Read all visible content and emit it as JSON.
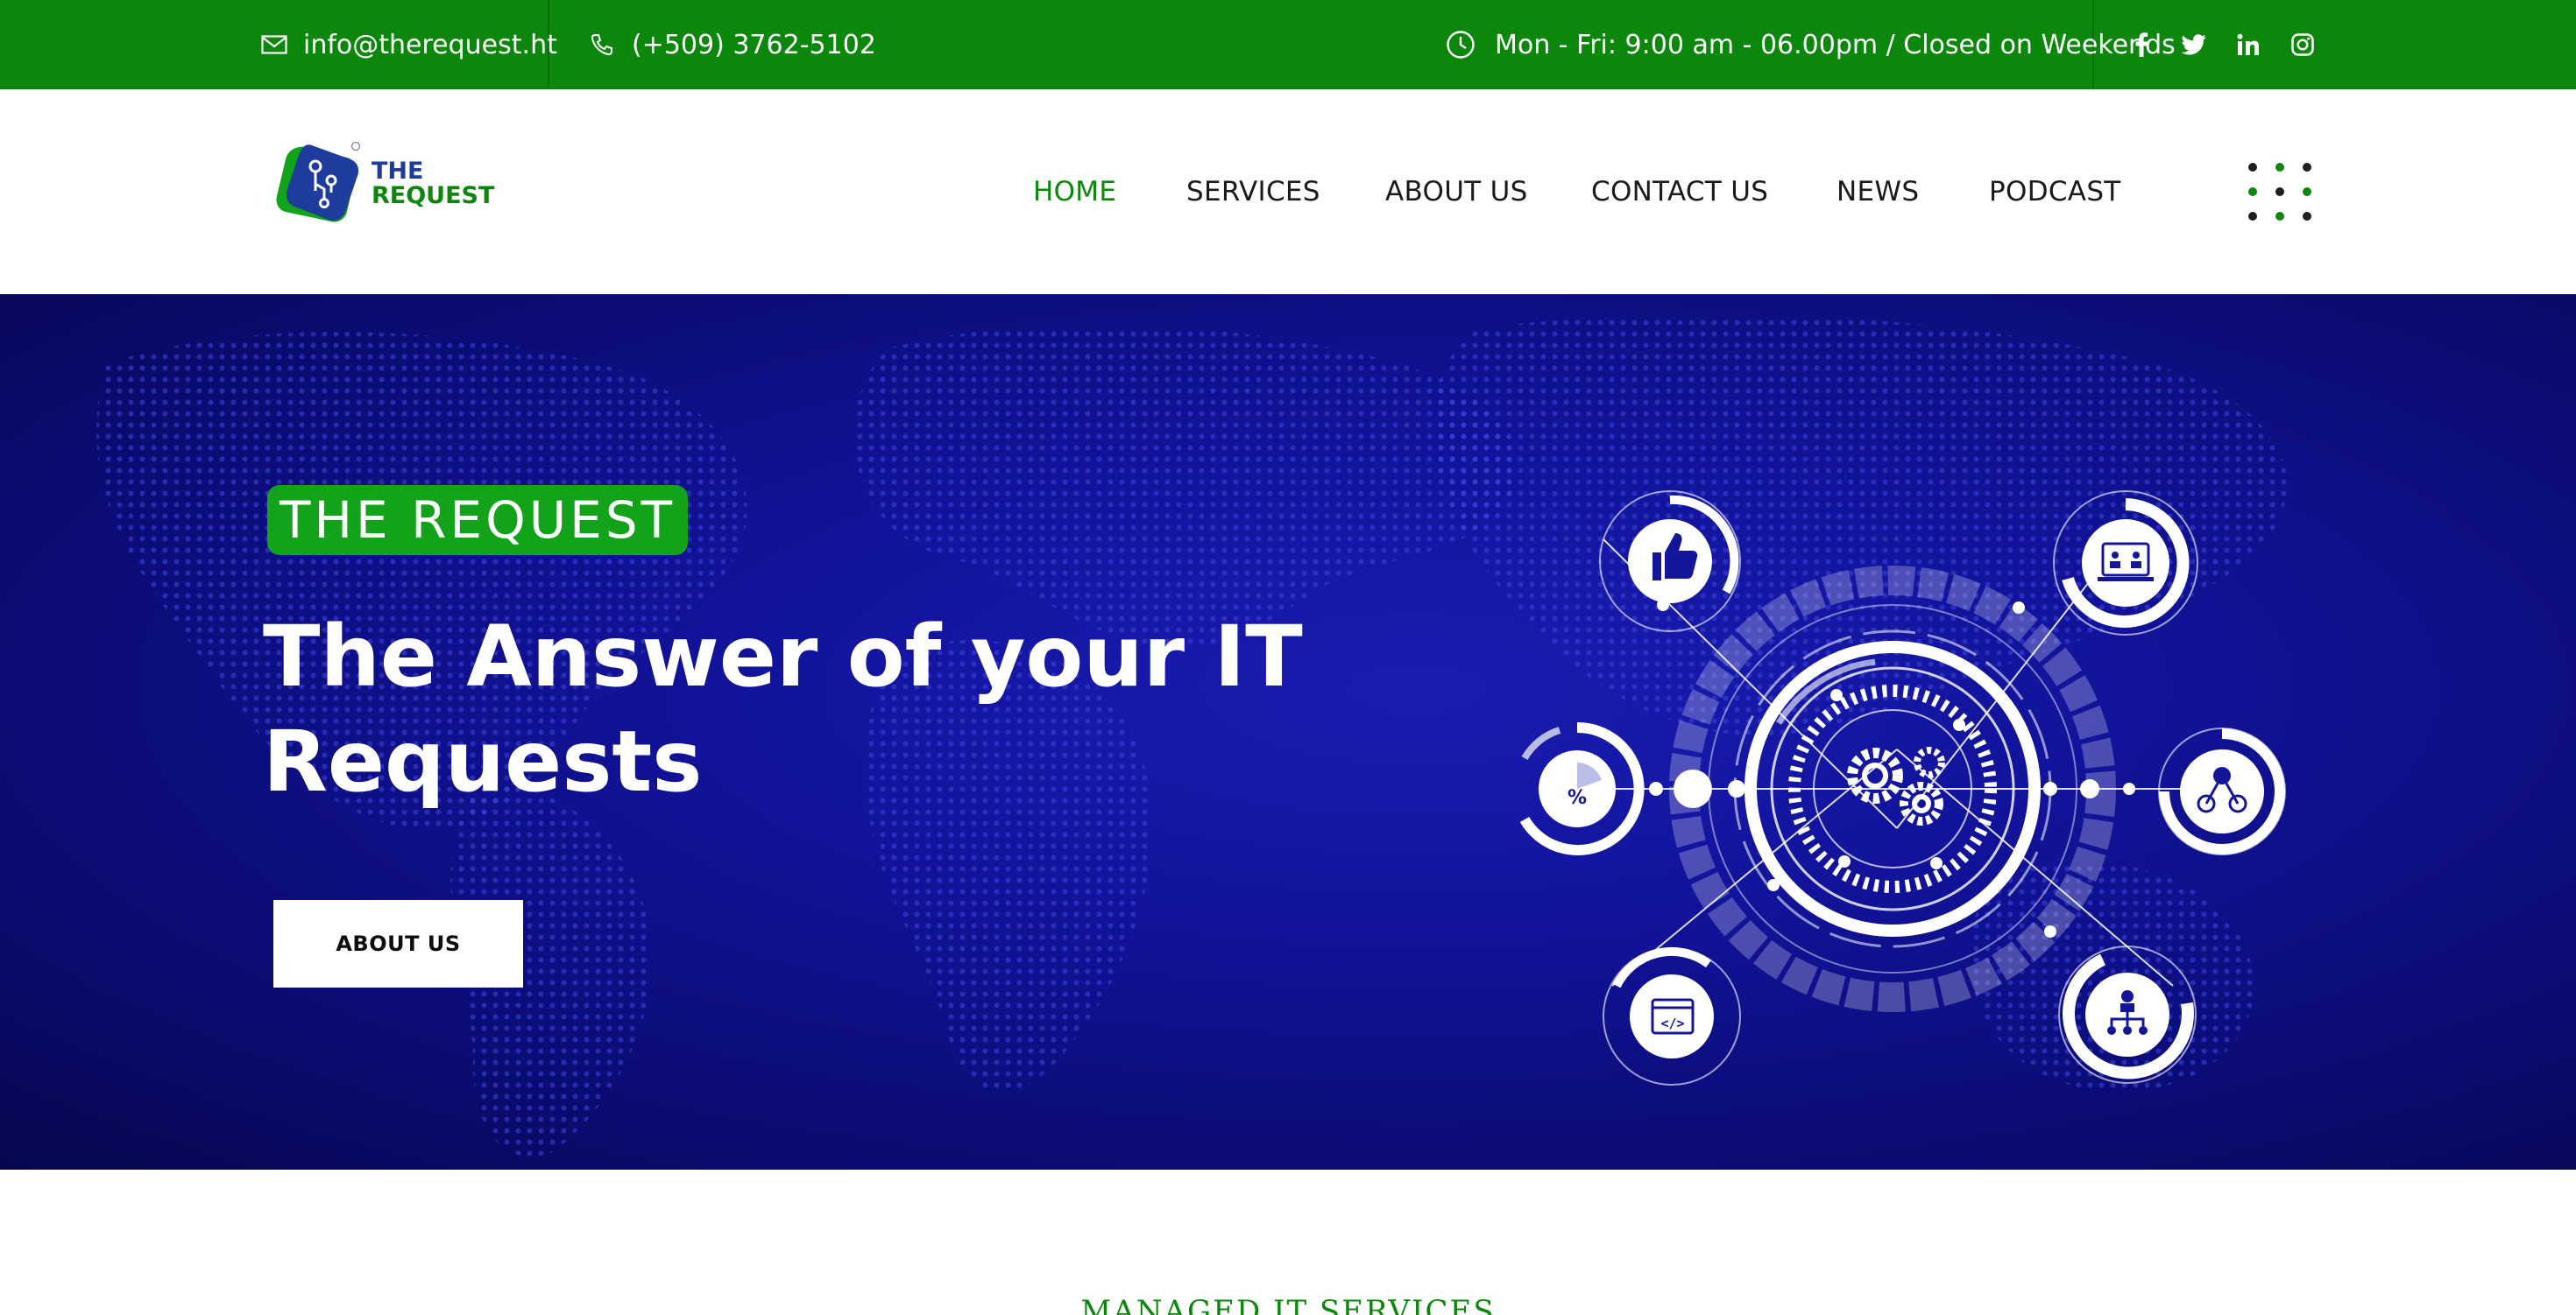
{
  "topbar": {
    "email": "info@therequest.ht",
    "phone": "(+509) 3762-5102",
    "hours": "Mon - Fri: 9:00 am - 06.00pm / Closed on Weekends",
    "social": [
      "facebook-icon",
      "twitter-icon",
      "linkedin-icon",
      "instagram-icon"
    ],
    "background": "#0b870b"
  },
  "logo": {
    "line1": "THE",
    "line2": "REQUEST"
  },
  "nav": {
    "items": [
      "HOME",
      "SERVICES",
      "ABOUT US",
      "CONTACT US",
      "NEWS",
      "PODCAST"
    ],
    "active": "HOME",
    "active_color": "#0b870b"
  },
  "hero": {
    "badge": "THE REQUEST",
    "title_line1": "The Answer of your IT",
    "title_line2": "Requests",
    "button": "ABOUT US",
    "badge_color": "#13a31a",
    "background": "#12139a",
    "graphic_icons": [
      "thumbs-up-icon",
      "video-conference-icon",
      "percent-chart-icon",
      "network-nodes-icon",
      "code-window-icon",
      "org-chart-icon",
      "gears-icon"
    ]
  },
  "section": {
    "label": "MANAGED IT SERVICES"
  }
}
